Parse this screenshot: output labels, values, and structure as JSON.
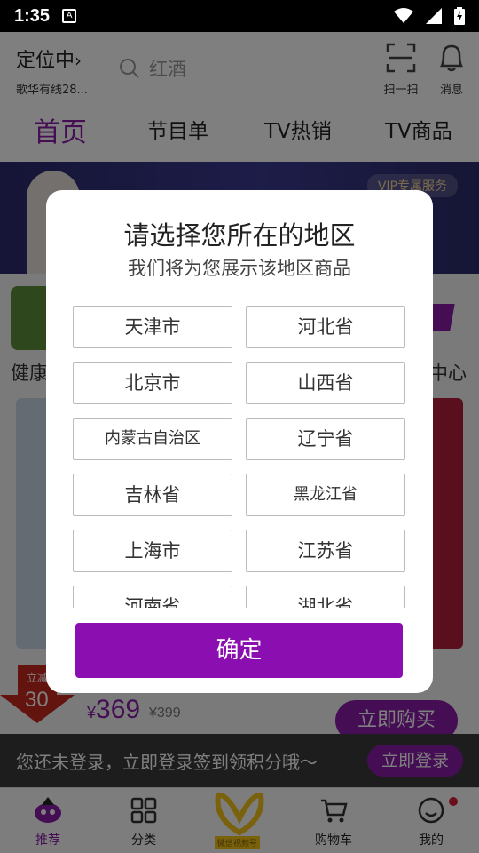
{
  "status_bar": {
    "time": "1:35",
    "sim_icon_letter": "A"
  },
  "header": {
    "location_label": "定位中",
    "location_address": "歌华有线28...",
    "search_placeholder": "红酒",
    "scan_label": "扫一扫",
    "message_label": "消息"
  },
  "tabs": [
    {
      "label": "首页",
      "active": true
    },
    {
      "label": "节目单"
    },
    {
      "label": "TV热销"
    },
    {
      "label": "TV商品"
    }
  ],
  "banner": {
    "vip_label": "VIP专属服务"
  },
  "content": {
    "category_left": "健康",
    "category_right": "中心",
    "discount_label": "立减",
    "discount_value": "30",
    "price_currency": "¥",
    "price": "369",
    "original_price": "¥399",
    "buy_button": "立即购买"
  },
  "login_bar": {
    "text": "您还未登录，立即登录签到领积分哦～",
    "button": "立即登录"
  },
  "bottom_nav": {
    "items": [
      {
        "label": "推荐",
        "icon": "recommend-icon",
        "active": true
      },
      {
        "label": "分类",
        "icon": "grid-icon"
      },
      {
        "label": "微信视频号",
        "icon": "wechat-channels-icon"
      },
      {
        "label": "购物车",
        "icon": "cart-icon"
      },
      {
        "label": "我的",
        "icon": "profile-icon"
      }
    ]
  },
  "modal": {
    "title": "请选择您所在的地区",
    "subtitle": "我们将为您展示该地区商品",
    "regions": [
      "天津市",
      "河北省",
      "北京市",
      "山西省",
      "内蒙古自治区",
      "辽宁省",
      "吉林省",
      "黑龙江省",
      "上海市",
      "江苏省",
      "河南省",
      "湖北省"
    ],
    "confirm_label": "确定"
  },
  "colors": {
    "accent": "#8b1ca9",
    "confirm": "#8b0fb0",
    "overlay": "rgba(0,0,0,0.5)"
  }
}
